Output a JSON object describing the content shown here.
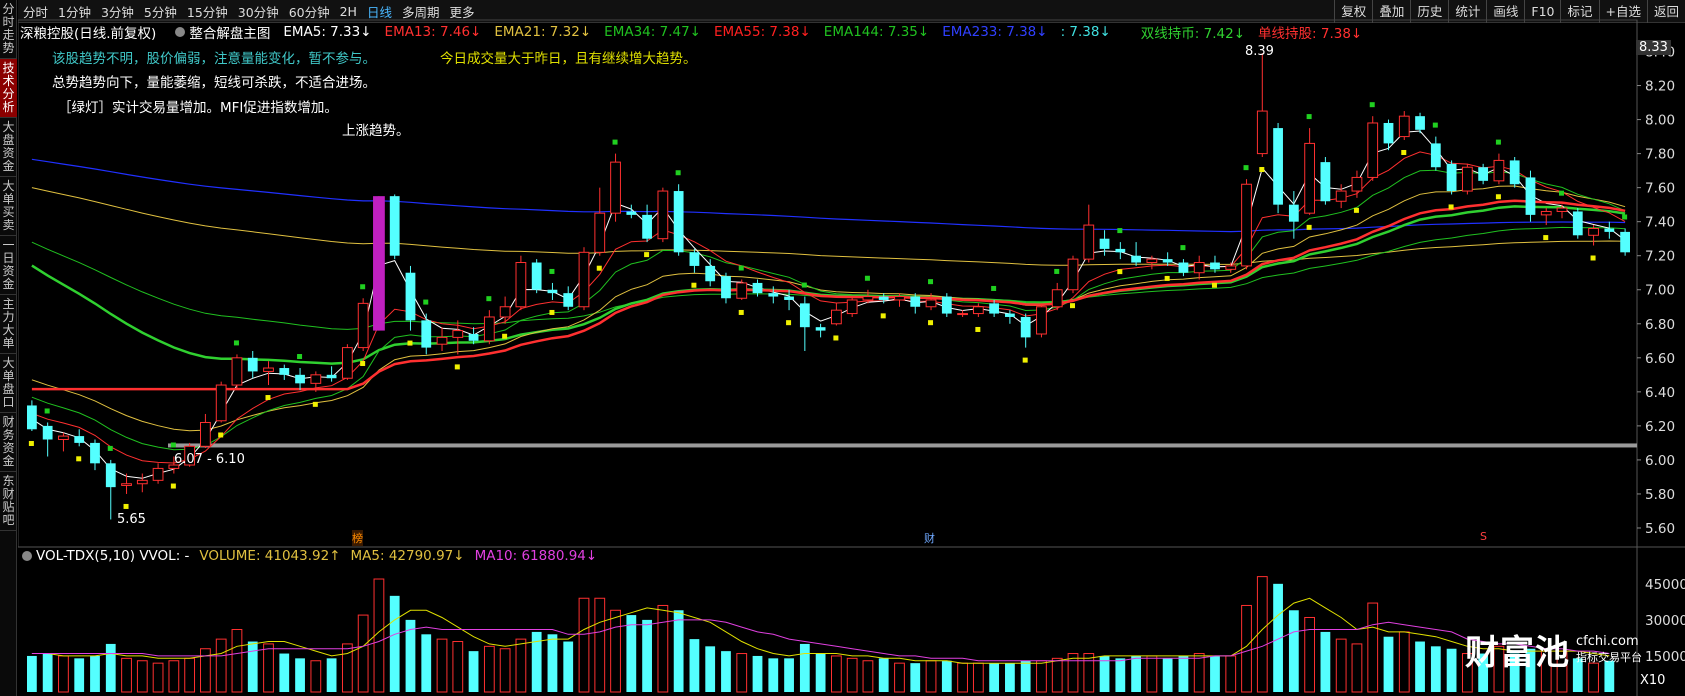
{
  "left_tabs": [
    {
      "label": "分时走势",
      "active": false
    },
    {
      "label": "技术分析",
      "active": true
    },
    {
      "label": "大盘资金",
      "active": false
    },
    {
      "label": "大单买卖",
      "active": false
    },
    {
      "label": "一日资金",
      "active": false
    },
    {
      "label": "主力大单",
      "active": false
    },
    {
      "label": "大单盘口",
      "active": false
    },
    {
      "label": "财务资金",
      "active": false
    },
    {
      "label": "东财贴吧",
      "active": false
    }
  ],
  "period_tabs": [
    {
      "label": "分时",
      "active": false
    },
    {
      "label": "1分钟",
      "active": false
    },
    {
      "label": "3分钟",
      "active": false
    },
    {
      "label": "5分钟",
      "active": false
    },
    {
      "label": "15分钟",
      "active": false
    },
    {
      "label": "30分钟",
      "active": false
    },
    {
      "label": "60分钟",
      "active": false
    },
    {
      "label": "2H",
      "active": false
    },
    {
      "label": "日线",
      "active": true
    },
    {
      "label": "多周期",
      "active": false
    },
    {
      "label": "更多",
      "active": false
    }
  ],
  "right_tools": [
    "复权",
    "叠加",
    "历史",
    "统计",
    "画线",
    "F10",
    "标记",
    "+自选",
    "返回"
  ],
  "info": {
    "stock": "深粮控股(日线.前复权)",
    "indicator": "整合解盘主图",
    "ema5": "EMA5: 7.33↓",
    "ema13": "EMA13: 7.46↓",
    "ema21": "EMA21: 7.32↓",
    "ema34": "EMA34: 7.47↓",
    "ema55": "EMA55: 7.38↓",
    "ema144": "EMA144: 7.35↓",
    "ema233": "EMA233: 7.38↓",
    "colon": ": 7.38↓",
    "double": "双线持币: 7.42↓",
    "single": "单线持股: 7.38↓"
  },
  "notes": {
    "line1": "该股趋势不明，股价偏弱，注意量能变化，暂不参与。",
    "line1b": "今日成交量大于昨日，且有继续增大趋势。",
    "line2": "总势趋势向下，量能萎缩，短线可杀跌，不适合进场。",
    "line3": "［绿灯］实计交易量增加。MFI促进指数增加。",
    "line4": "上涨趋势。"
  },
  "annotations": {
    "high": "8.39",
    "low": "5.65",
    "band": "6.07 - 6.10",
    "mark_bang": "榜",
    "mark_cai": "财",
    "mark_s": "S"
  },
  "price_axis": {
    "labels": [
      "8.40",
      "8.20",
      "8.00",
      "7.80",
      "7.60",
      "7.40",
      "7.20",
      "7.00",
      "6.80",
      "6.60",
      "6.40",
      "6.20",
      "6.00",
      "5.80",
      "5.60"
    ],
    "current": "8.33"
  },
  "volume": {
    "title": "VOL-TDX(5,10) VVOL: -",
    "volume": "VOLUME: 41043.92↑",
    "ma5": "MA5: 42790.97↓",
    "ma10": "MA10: 61880.94↓",
    "axis": [
      "45000",
      "30000",
      "15000"
    ],
    "unit": "X10"
  },
  "watermark": {
    "main": "财富池",
    "url": "cfchi.com",
    "slogan": "指标交易平台"
  },
  "colors": {
    "up": "#ff3030",
    "down": "#54ffff",
    "ema5": "#ffffff",
    "ema13": "#ff3030",
    "ema21": "#e0c040",
    "ema34": "#20c020",
    "ema55": "#ff2020",
    "ema144": "#20c020",
    "ema233": "#2030ff",
    "double": "#30d030",
    "single": "#ff3030",
    "note1": "#40c8c8",
    "note1b": "#e0e000",
    "ma5": "#e0e000",
    "ma10": "#e040e0"
  },
  "chart_data": {
    "type": "candlestick",
    "ylim": [
      5.5,
      8.45
    ],
    "candles": [
      {
        "o": 6.32,
        "h": 6.35,
        "l": 6.17,
        "c": 6.18
      },
      {
        "o": 6.2,
        "h": 6.22,
        "l": 6.02,
        "c": 6.12
      },
      {
        "o": 6.12,
        "h": 6.16,
        "l": 6.05,
        "c": 6.14
      },
      {
        "o": 6.14,
        "h": 6.18,
        "l": 6.08,
        "c": 6.1
      },
      {
        "o": 6.1,
        "h": 6.12,
        "l": 5.94,
        "c": 5.98
      },
      {
        "o": 5.98,
        "h": 6.0,
        "l": 5.65,
        "c": 5.84
      },
      {
        "o": 5.85,
        "h": 5.92,
        "l": 5.8,
        "c": 5.86
      },
      {
        "o": 5.86,
        "h": 5.92,
        "l": 5.81,
        "c": 5.88
      },
      {
        "o": 5.88,
        "h": 5.98,
        "l": 5.86,
        "c": 5.95
      },
      {
        "o": 5.95,
        "h": 6.02,
        "l": 5.92,
        "c": 5.97
      },
      {
        "o": 5.97,
        "h": 6.1,
        "l": 5.96,
        "c": 6.08
      },
      {
        "o": 6.08,
        "h": 6.27,
        "l": 6.07,
        "c": 6.22
      },
      {
        "o": 6.23,
        "h": 6.46,
        "l": 6.22,
        "c": 6.44
      },
      {
        "o": 6.44,
        "h": 6.62,
        "l": 6.42,
        "c": 6.6
      },
      {
        "o": 6.6,
        "h": 6.64,
        "l": 6.48,
        "c": 6.52
      },
      {
        "o": 6.52,
        "h": 6.58,
        "l": 6.44,
        "c": 6.54
      },
      {
        "o": 6.54,
        "h": 6.56,
        "l": 6.47,
        "c": 6.5
      },
      {
        "o": 6.5,
        "h": 6.54,
        "l": 6.41,
        "c": 6.45
      },
      {
        "o": 6.45,
        "h": 6.52,
        "l": 6.4,
        "c": 6.5
      },
      {
        "o": 6.5,
        "h": 6.55,
        "l": 6.46,
        "c": 6.48
      },
      {
        "o": 6.48,
        "h": 6.68,
        "l": 6.47,
        "c": 6.66
      },
      {
        "o": 6.66,
        "h": 6.95,
        "l": 6.64,
        "c": 6.92
      },
      {
        "o": 6.78,
        "h": 7.55,
        "l": 6.76,
        "c": 7.54
      },
      {
        "o": 7.55,
        "h": 7.56,
        "l": 7.18,
        "c": 7.2
      },
      {
        "o": 7.1,
        "h": 7.14,
        "l": 6.76,
        "c": 6.82
      },
      {
        "o": 6.82,
        "h": 6.86,
        "l": 6.62,
        "c": 6.66
      },
      {
        "o": 6.68,
        "h": 6.78,
        "l": 6.64,
        "c": 6.72
      },
      {
        "o": 6.72,
        "h": 6.82,
        "l": 6.62,
        "c": 6.76
      },
      {
        "o": 6.74,
        "h": 6.78,
        "l": 6.68,
        "c": 6.7
      },
      {
        "o": 6.7,
        "h": 6.88,
        "l": 6.68,
        "c": 6.84
      },
      {
        "o": 6.84,
        "h": 6.96,
        "l": 6.8,
        "c": 6.9
      },
      {
        "o": 6.9,
        "h": 7.2,
        "l": 6.88,
        "c": 7.16
      },
      {
        "o": 7.16,
        "h": 7.18,
        "l": 6.98,
        "c": 7.0
      },
      {
        "o": 7.0,
        "h": 7.04,
        "l": 6.94,
        "c": 6.98
      },
      {
        "o": 6.98,
        "h": 7.02,
        "l": 6.88,
        "c": 6.9
      },
      {
        "o": 6.9,
        "h": 7.25,
        "l": 6.88,
        "c": 7.22
      },
      {
        "o": 7.22,
        "h": 7.6,
        "l": 7.2,
        "c": 7.45
      },
      {
        "o": 7.45,
        "h": 7.8,
        "l": 7.4,
        "c": 7.75
      },
      {
        "o": 7.46,
        "h": 7.5,
        "l": 7.42,
        "c": 7.44
      },
      {
        "o": 7.44,
        "h": 7.5,
        "l": 7.28,
        "c": 7.3
      },
      {
        "o": 7.3,
        "h": 7.6,
        "l": 7.28,
        "c": 7.58
      },
      {
        "o": 7.58,
        "h": 7.62,
        "l": 7.2,
        "c": 7.22
      },
      {
        "o": 7.22,
        "h": 7.24,
        "l": 7.1,
        "c": 7.14
      },
      {
        "o": 7.14,
        "h": 7.18,
        "l": 7.02,
        "c": 7.05
      },
      {
        "o": 7.08,
        "h": 7.1,
        "l": 6.92,
        "c": 6.95
      },
      {
        "o": 6.95,
        "h": 7.06,
        "l": 6.94,
        "c": 7.04
      },
      {
        "o": 7.04,
        "h": 7.06,
        "l": 6.96,
        "c": 6.98
      },
      {
        "o": 6.98,
        "h": 7.02,
        "l": 6.92,
        "c": 6.96
      },
      {
        "o": 6.96,
        "h": 7.0,
        "l": 6.88,
        "c": 6.94
      },
      {
        "o": 6.92,
        "h": 6.96,
        "l": 6.64,
        "c": 6.78
      },
      {
        "o": 6.78,
        "h": 6.8,
        "l": 6.72,
        "c": 6.76
      },
      {
        "o": 6.8,
        "h": 6.92,
        "l": 6.79,
        "c": 6.88
      },
      {
        "o": 6.86,
        "h": 6.96,
        "l": 6.84,
        "c": 6.94
      },
      {
        "o": 6.94,
        "h": 7.0,
        "l": 6.92,
        "c": 6.96
      },
      {
        "o": 6.96,
        "h": 6.98,
        "l": 6.92,
        "c": 6.94
      },
      {
        "o": 6.94,
        "h": 6.98,
        "l": 6.9,
        "c": 6.96
      },
      {
        "o": 6.96,
        "h": 6.98,
        "l": 6.86,
        "c": 6.9
      },
      {
        "o": 6.9,
        "h": 6.98,
        "l": 6.88,
        "c": 6.94
      },
      {
        "o": 6.96,
        "h": 6.98,
        "l": 6.84,
        "c": 6.86
      },
      {
        "o": 6.86,
        "h": 6.88,
        "l": 6.84,
        "c": 6.86
      },
      {
        "o": 6.86,
        "h": 6.92,
        "l": 6.84,
        "c": 6.9
      },
      {
        "o": 6.92,
        "h": 6.94,
        "l": 6.84,
        "c": 6.86
      },
      {
        "o": 6.86,
        "h": 6.88,
        "l": 6.8,
        "c": 6.84
      },
      {
        "o": 6.84,
        "h": 6.86,
        "l": 6.66,
        "c": 6.72
      },
      {
        "o": 6.74,
        "h": 6.92,
        "l": 6.72,
        "c": 6.9
      },
      {
        "o": 6.9,
        "h": 7.04,
        "l": 6.88,
        "c": 7.0
      },
      {
        "o": 7.0,
        "h": 7.2,
        "l": 6.98,
        "c": 7.18
      },
      {
        "o": 7.18,
        "h": 7.5,
        "l": 7.16,
        "c": 7.38
      },
      {
        "o": 7.3,
        "h": 7.35,
        "l": 7.2,
        "c": 7.24
      },
      {
        "o": 7.24,
        "h": 7.28,
        "l": 7.18,
        "c": 7.22
      },
      {
        "o": 7.2,
        "h": 7.28,
        "l": 7.14,
        "c": 7.16
      },
      {
        "o": 7.16,
        "h": 7.2,
        "l": 7.12,
        "c": 7.18
      },
      {
        "o": 7.18,
        "h": 7.22,
        "l": 7.14,
        "c": 7.16
      },
      {
        "o": 7.16,
        "h": 7.18,
        "l": 7.08,
        "c": 7.1
      },
      {
        "o": 7.1,
        "h": 7.2,
        "l": 7.06,
        "c": 7.16
      },
      {
        "o": 7.16,
        "h": 7.2,
        "l": 7.1,
        "c": 7.12
      },
      {
        "o": 7.12,
        "h": 7.16,
        "l": 7.1,
        "c": 7.14
      },
      {
        "o": 7.14,
        "h": 7.65,
        "l": 7.12,
        "c": 7.62
      },
      {
        "o": 7.8,
        "h": 8.39,
        "l": 7.78,
        "c": 8.05
      },
      {
        "o": 7.95,
        "h": 7.98,
        "l": 7.45,
        "c": 7.5
      },
      {
        "o": 7.5,
        "h": 7.58,
        "l": 7.3,
        "c": 7.4
      },
      {
        "o": 7.45,
        "h": 7.95,
        "l": 7.44,
        "c": 7.86
      },
      {
        "o": 7.75,
        "h": 7.78,
        "l": 7.5,
        "c": 7.52
      },
      {
        "o": 7.52,
        "h": 7.62,
        "l": 7.48,
        "c": 7.58
      },
      {
        "o": 7.58,
        "h": 7.7,
        "l": 7.54,
        "c": 7.66
      },
      {
        "o": 7.66,
        "h": 8.02,
        "l": 7.64,
        "c": 7.98
      },
      {
        "o": 7.98,
        "h": 8.0,
        "l": 7.82,
        "c": 7.86
      },
      {
        "o": 7.9,
        "h": 8.05,
        "l": 7.88,
        "c": 8.02
      },
      {
        "o": 8.02,
        "h": 8.04,
        "l": 7.92,
        "c": 7.94
      },
      {
        "o": 7.86,
        "h": 7.9,
        "l": 7.7,
        "c": 7.72
      },
      {
        "o": 7.74,
        "h": 7.76,
        "l": 7.56,
        "c": 7.58
      },
      {
        "o": 7.58,
        "h": 7.74,
        "l": 7.56,
        "c": 7.72
      },
      {
        "o": 7.72,
        "h": 7.74,
        "l": 7.62,
        "c": 7.64
      },
      {
        "o": 7.64,
        "h": 7.8,
        "l": 7.62,
        "c": 7.76
      },
      {
        "o": 7.76,
        "h": 7.78,
        "l": 7.6,
        "c": 7.62
      },
      {
        "o": 7.66,
        "h": 7.7,
        "l": 7.4,
        "c": 7.44
      },
      {
        "o": 7.44,
        "h": 7.48,
        "l": 7.38,
        "c": 7.46
      },
      {
        "o": 7.46,
        "h": 7.5,
        "l": 7.42,
        "c": 7.48
      },
      {
        "o": 7.46,
        "h": 7.48,
        "l": 7.3,
        "c": 7.32
      },
      {
        "o": 7.32,
        "h": 7.38,
        "l": 7.26,
        "c": 7.36
      },
      {
        "o": 7.36,
        "h": 7.4,
        "l": 7.3,
        "c": 7.34
      },
      {
        "o": 7.34,
        "h": 7.36,
        "l": 7.2,
        "c": 7.22
      }
    ],
    "volumes": [
      15,
      16,
      15,
      14,
      15,
      20,
      14,
      13,
      12,
      13,
      14,
      18,
      22,
      26,
      21,
      20,
      16,
      14,
      13,
      14,
      20,
      32,
      47,
      40,
      30,
      24,
      22,
      21,
      17,
      19,
      18,
      22,
      25,
      24,
      21,
      39,
      39,
      34,
      32,
      30,
      36,
      34,
      22,
      19,
      17,
      16,
      15,
      14,
      14,
      20,
      16,
      15,
      14,
      13,
      14,
      12,
      12,
      13,
      13,
      12,
      12,
      12,
      12,
      13,
      13,
      14,
      16,
      16,
      15,
      14,
      15,
      15,
      14,
      15,
      16,
      15,
      15,
      36,
      48,
      45,
      34,
      31,
      25,
      22,
      20,
      37,
      23,
      25,
      21,
      19,
      18,
      16,
      16,
      19,
      16,
      18,
      17,
      17,
      14,
      12,
      13
    ],
    "ma5_vol": [
      16,
      16,
      15,
      15,
      15,
      16,
      15,
      15,
      14,
      14,
      14,
      15,
      16,
      19,
      20,
      21,
      21,
      19,
      17,
      15,
      16,
      19,
      25,
      30,
      34,
      34,
      31,
      27,
      23,
      20,
      19,
      20,
      21,
      22,
      22,
      26,
      29,
      31,
      33,
      35,
      34,
      33,
      31,
      29,
      25,
      21,
      18,
      16,
      15,
      16,
      16,
      16,
      15,
      15,
      14,
      14,
      13,
      13,
      13,
      12,
      12,
      12,
      12,
      12,
      12,
      13,
      14,
      14,
      15,
      15,
      15,
      15,
      15,
      15,
      15,
      15,
      15,
      19,
      26,
      32,
      37,
      39,
      35,
      31,
      26,
      27,
      25,
      25,
      24,
      23,
      21,
      19,
      18,
      18,
      17,
      17,
      17,
      17,
      17,
      16,
      15
    ],
    "ma10_vol": [
      16,
      16,
      16,
      16,
      16,
      16,
      16,
      16,
      15,
      15,
      15,
      15,
      15,
      16,
      17,
      18,
      18,
      18,
      18,
      18,
      18,
      19,
      21,
      24,
      26,
      27,
      26,
      26,
      26,
      26,
      26,
      26,
      26,
      26,
      24,
      24,
      25,
      27,
      28,
      28,
      29,
      30,
      30,
      30,
      29,
      27,
      25,
      24,
      22,
      21,
      20,
      19,
      18,
      17,
      16,
      15,
      15,
      14,
      14,
      14,
      13,
      13,
      13,
      13,
      13,
      13,
      13,
      13,
      13,
      13,
      14,
      14,
      14,
      14,
      14,
      15,
      15,
      17,
      19,
      22,
      25,
      26,
      26,
      26,
      26,
      28,
      29,
      28,
      27,
      26,
      25,
      22,
      21,
      20,
      20,
      19,
      18,
      18,
      17,
      17,
      16
    ]
  }
}
